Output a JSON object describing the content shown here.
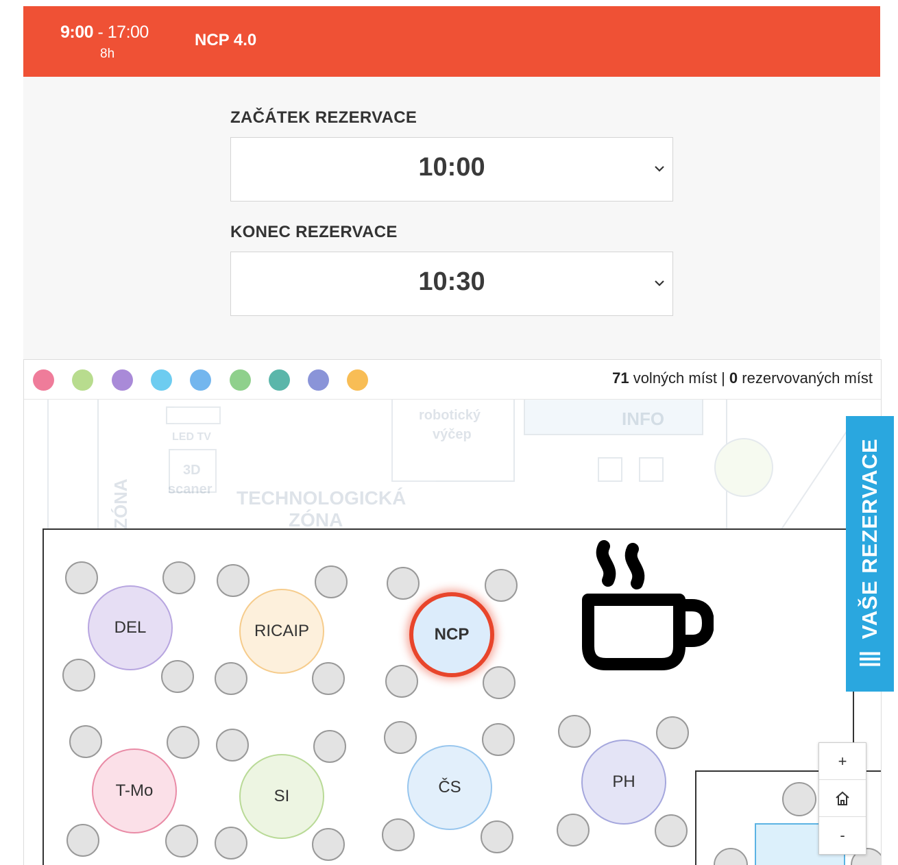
{
  "header": {
    "time_start": "9:00",
    "time_end": " - 17:00",
    "duration": "8h",
    "space_name": "NCP 4.0",
    "bg_color": "#ef5135"
  },
  "reservation": {
    "start_label": "ZAČÁTEK REZERVACE",
    "start_value": "10:00",
    "end_label": "KONEC REZERVACE",
    "end_value": "10:30"
  },
  "filters": {
    "colors": [
      "#ef7c9a",
      "#b8dc8e",
      "#a98ad8",
      "#6dccf0",
      "#73b6ee",
      "#8fd08c",
      "#5bb6aa",
      "#8a94d8",
      "#f8bd55"
    ]
  },
  "stats": {
    "free_count": "71",
    "free_label": " volných míst",
    "separator": " | ",
    "reserved_count": "0",
    "reserved_label": " rezervovaných míst"
  },
  "background_plan": {
    "labels": [
      "robotický",
      "výčep",
      "INFO",
      "TECHNOLOGICKÁ",
      "ZÓNA",
      "LED TV",
      "3D",
      "scaner",
      "ZÓNA"
    ]
  },
  "tables": [
    {
      "label": "DEL",
      "fill": "#e6def4",
      "stroke": "#b7a5e0"
    },
    {
      "label": "RICAIP",
      "fill": "#fdf0dc",
      "stroke": "#f6cc8c"
    },
    {
      "label": "NCP",
      "fill": "#dcecfb",
      "stroke": "#e8452b",
      "selected": true
    },
    {
      "label": "T-Mo",
      "fill": "#fbe0e8",
      "stroke": "#e98ba6"
    },
    {
      "label": "SI",
      "fill": "#edf5e2",
      "stroke": "#b9da97"
    },
    {
      "label": "ČS",
      "fill": "#e2effb",
      "stroke": "#98c6ee"
    },
    {
      "label": "PH",
      "fill": "#e4e4f6",
      "stroke": "#a5a7dd"
    }
  ],
  "zoom": {
    "plus": "+",
    "home_icon": "home-icon",
    "minus": "-"
  },
  "side_tab": {
    "label": "VAŠE REZERVACE",
    "bg_color": "#2aa7df"
  }
}
